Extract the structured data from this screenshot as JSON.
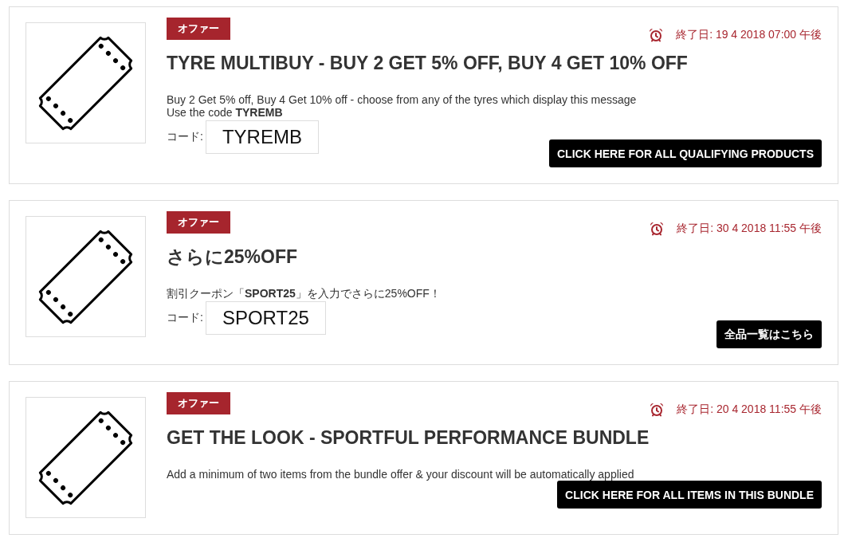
{
  "offers": [
    {
      "badge": "オファー",
      "end_date": "終了日: 19 4 2018 07:00 午後",
      "title": "TYRE MULTIBUY - BUY 2 GET 5% OFF, BUY 4 GET 10% OFF",
      "description": [
        "Buy 2 Get 5% off, Buy 4 Get 10% off - choose from any of the tyres which display this message",
        "Use the code **TYREMB**"
      ],
      "code_label": "コード:",
      "code": "TYREMB",
      "button": "CLICK HERE FOR ALL QUALIFYING PRODUCTS"
    },
    {
      "badge": "オファー",
      "end_date": "終了日: 30 4 2018 11:55 午後",
      "title": "さらに25%OFF",
      "description": [
        "割引クーポン「**SPORT25**」を入力でさらに25%OFF！"
      ],
      "code_label": "コード:",
      "code": "SPORT25",
      "button": "全品一覧はこちら"
    },
    {
      "badge": "オファー",
      "end_date": "終了日: 20 4 2018 11:55 午後",
      "title": "GET THE LOOK - SPORTFUL PERFORMANCE BUNDLE",
      "description": [
        "Add a minimum of two items from the bundle offer & your discount will be automatically applied"
      ],
      "button": "CLICK HERE FOR ALL ITEMS IN THIS BUNDLE"
    }
  ]
}
